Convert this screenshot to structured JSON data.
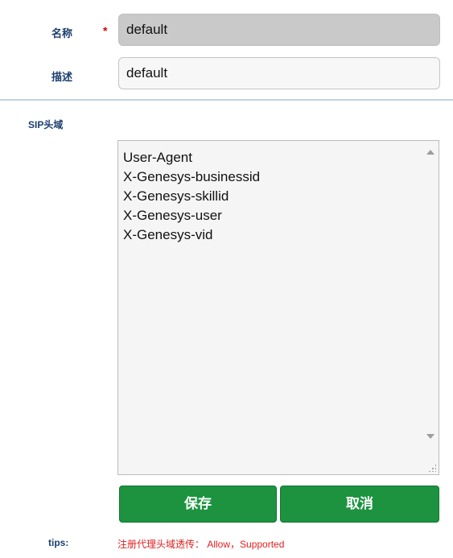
{
  "form": {
    "name_label": "名称",
    "required_mark": "*",
    "name_value": "default",
    "description_label": "描述",
    "description_value": "default"
  },
  "sip_headers": {
    "label": "SIP头域",
    "items": [
      "User-Agent",
      "X-Genesys-businessid",
      "X-Genesys-skillid",
      "X-Genesys-user",
      "X-Genesys-vid"
    ]
  },
  "actions": {
    "save_label": "保存",
    "cancel_label": "取消"
  },
  "tips": {
    "label": "tips:",
    "text": "注册代理头域透传： Allow，Supported"
  },
  "colors": {
    "button_green": "#1d9340",
    "label_blue": "#1c3f6e",
    "tips_red": "#e02020",
    "required_red": "#d40000"
  }
}
